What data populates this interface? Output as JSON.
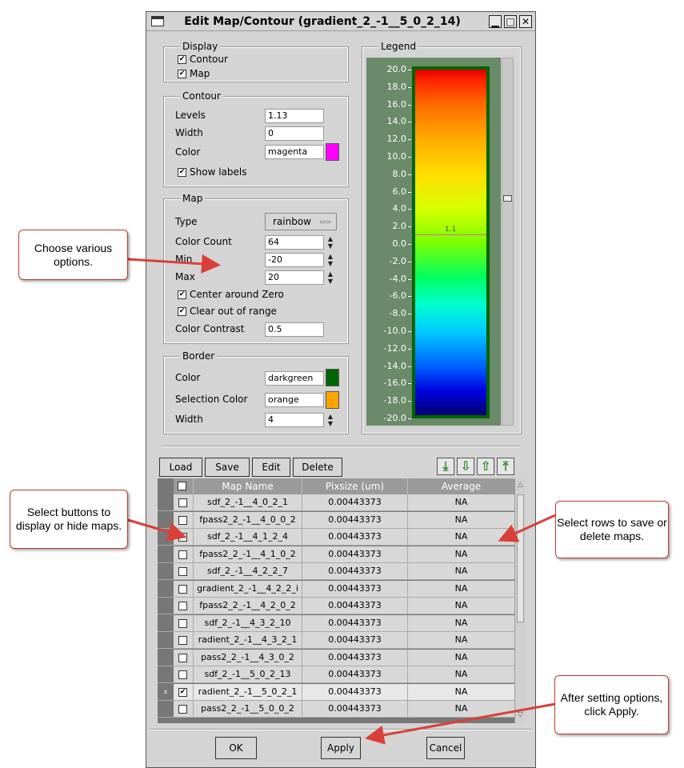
{
  "window": {
    "title": "Edit Map/Contour (gradient_2_-1__5_0_2_14)",
    "minimize_glyph": "▁",
    "maximize_glyph": "□",
    "close_glyph": "✕"
  },
  "display": {
    "title": "Display",
    "contour_label": "Contour",
    "contour_checked": true,
    "map_label": "Map",
    "map_checked": true
  },
  "contour": {
    "title": "Contour",
    "levels_label": "Levels",
    "levels_value": "1.13",
    "width_label": "Width",
    "width_value": "0",
    "color_label": "Color",
    "color_value": "magenta",
    "color_hex": "#ff00ff",
    "show_labels_label": "Show labels",
    "show_labels_checked": true
  },
  "map": {
    "title": "Map",
    "type_label": "Type",
    "type_value": "rainbow",
    "color_count_label": "Color Count",
    "color_count_value": "64",
    "min_label": "Min",
    "min_value": "-20",
    "max_label": "Max",
    "max_value": "20",
    "center_zero_label": "Center around Zero",
    "center_zero_checked": true,
    "clear_range_label": "Clear out of range",
    "clear_range_checked": true,
    "contrast_label": "Color Contrast",
    "contrast_value": "0.5"
  },
  "border": {
    "title": "Border",
    "color_label": "Color",
    "color_value": "darkgreen",
    "color_hex": "#006400",
    "selection_color_label": "Selection Color",
    "selection_color_value": "orange",
    "selection_color_hex": "#ffa500",
    "width_label": "Width",
    "width_value": "4"
  },
  "legend": {
    "title": "Legend",
    "ticks": [
      "20.0",
      "18.0",
      "16.0",
      "14.0",
      "12.0",
      "10.0",
      "8.0",
      "6.0",
      "4.0",
      "2.0",
      "0.0",
      "-2.0",
      "-4.0",
      "-6.0",
      "-8.0",
      "-10.0",
      "-12.0",
      "-14.0",
      "-16.0",
      "-18.0",
      "-20.0"
    ],
    "contour_label": "1.1",
    "min": -20,
    "max": 20,
    "contour_level": 1.13
  },
  "toolbar": {
    "load_label": "Load",
    "save_label": "Save",
    "edit_label": "Edit",
    "delete_label": "Delete",
    "move_bottom_icon": "move-to-bottom-icon",
    "move_down_icon": "move-down-icon",
    "move_up_icon": "move-up-icon",
    "move_top_icon": "move-to-top-icon"
  },
  "table": {
    "headers": [
      "Map Name",
      "Pixsize (um)",
      "Average"
    ],
    "rows": [
      {
        "name": "sdf_2_-1__4_0_2_1",
        "pixsize": "0.00443373",
        "average": "NA",
        "checked": false,
        "selected": false
      },
      {
        "name": "fpass2_2_-1__4_0_0_2",
        "pixsize": "0.00443373",
        "average": "NA",
        "checked": false,
        "selected": false
      },
      {
        "name": "sdf_2_-1__4_1_2_4",
        "pixsize": "0.00443373",
        "average": "NA",
        "checked": false,
        "selected": false
      },
      {
        "name": "fpass2_2_-1__4_1_0_2",
        "pixsize": "0.00443373",
        "average": "NA",
        "checked": false,
        "selected": false
      },
      {
        "name": "sdf_2_-1__4_2_2_7",
        "pixsize": "0.00443373",
        "average": "NA",
        "checked": false,
        "selected": false
      },
      {
        "name": "gradient_2_-1__4_2_2_i",
        "pixsize": "0.00443373",
        "average": "NA",
        "checked": false,
        "selected": false
      },
      {
        "name": "fpass2_2_-1__4_2_0_2",
        "pixsize": "0.00443373",
        "average": "NA",
        "checked": false,
        "selected": false
      },
      {
        "name": "sdf_2_-1__4_3_2_10",
        "pixsize": "0.00443373",
        "average": "NA",
        "checked": false,
        "selected": false
      },
      {
        "name": "radient_2_-1__4_3_2_1",
        "pixsize": "0.00443373",
        "average": "NA",
        "checked": false,
        "selected": false
      },
      {
        "name": "pass2_2_-1__4_3_0_2",
        "pixsize": "0.00443373",
        "average": "NA",
        "checked": false,
        "selected": false
      },
      {
        "name": "sdf_2_-1__5_0_2_13",
        "pixsize": "0.00443373",
        "average": "NA",
        "checked": false,
        "selected": false
      },
      {
        "name": "radient_2_-1__5_0_2_1",
        "pixsize": "0.00443373",
        "average": "NA",
        "checked": true,
        "selected": true
      },
      {
        "name": "pass2_2_-1__5_0_0_2",
        "pixsize": "0.00443373",
        "average": "NA",
        "checked": false,
        "selected": false
      }
    ],
    "selected_marker": "x"
  },
  "footer": {
    "ok_label": "OK",
    "apply_label": "Apply",
    "cancel_label": "Cancel"
  },
  "callouts": {
    "options": "Choose various options.",
    "display_hide": "Select buttons to display or hide maps.",
    "rows": "Select rows to save or delete maps.",
    "apply": "After setting options, click Apply."
  },
  "colors": {
    "callout_arrow": "#d9403a",
    "legend_bg": "#6a8a6a",
    "legend_border": "#006400",
    "icon_green": "#2a8a2a"
  }
}
